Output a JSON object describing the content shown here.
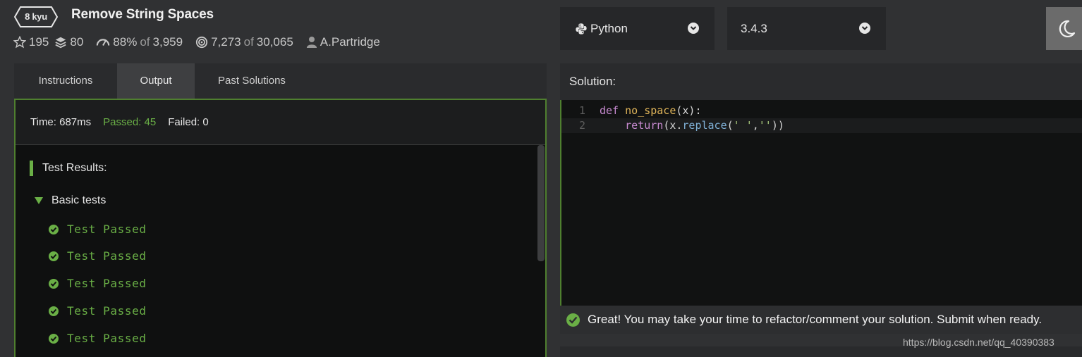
{
  "header": {
    "rank": "8 kyu",
    "title": "Remove String Spaces",
    "stats": {
      "stars": "195",
      "collections": "80",
      "satisfaction": "88%",
      "of_label": "of",
      "votes": "3,959",
      "completed": "7,273",
      "attempts": "30,065",
      "author": "A.Partridge"
    }
  },
  "selectors": {
    "language": "Python",
    "version": "3.4.3"
  },
  "tabs": [
    {
      "label": "Instructions"
    },
    {
      "label": "Output"
    },
    {
      "label": "Past Solutions"
    }
  ],
  "output": {
    "time": "Time: 687ms",
    "passed": "Passed: 45",
    "failed": "Failed: 0",
    "results_title": "Test Results:",
    "group": "Basic tests",
    "tests": [
      "Test Passed",
      "Test Passed",
      "Test Passed",
      "Test Passed",
      "Test Passed"
    ]
  },
  "solution": {
    "label": "Solution:",
    "lines": [
      {
        "num": "1",
        "kw": "def",
        "fn": "no_space",
        "rest": "(x):"
      },
      {
        "num": "2",
        "kw": "return",
        "a": "(x.",
        "method": "replace",
        "b": "(",
        "s1": "' '",
        "c": ",",
        "s2": "''",
        "d": "))"
      }
    ],
    "message": "Great! You may take your time to refactor/comment your solution. Submit when ready."
  },
  "watermark": "https://blog.csdn.net/qq_40390383",
  "colors": {
    "accent_green": "#6aaf46",
    "panel_border": "#4f7f2f",
    "background": "#303133"
  }
}
